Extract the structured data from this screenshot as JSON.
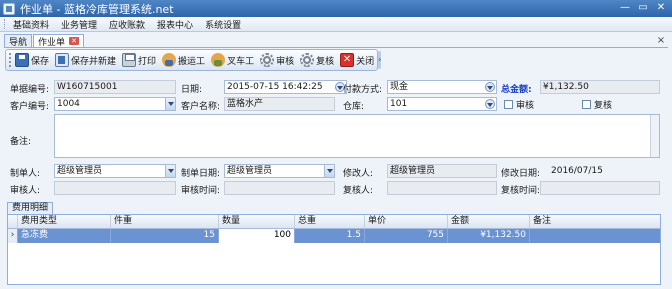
{
  "window": {
    "title": "作业单 - 蓝格冷库管理系统.net",
    "minimize": "—",
    "maximize": "▭",
    "close": "✕"
  },
  "menu": [
    "基础资料",
    "业务管理",
    "应收账款",
    "报表中心",
    "系统设置"
  ],
  "tabs": {
    "nav_label": "导航",
    "active_label": "作业单",
    "tab_close": "✕",
    "strip_close": "×"
  },
  "toolbar": {
    "save": "保存",
    "save_new": "保存并新建",
    "print": "打印",
    "porter": "搬运工",
    "forklift": "叉车工",
    "audit": "审核",
    "review": "复核",
    "close": "关闭",
    "more": "›"
  },
  "form": {
    "order_no_label": "单据编号:",
    "order_no": "W160715001",
    "date_label": "日期:",
    "date": "2015-07-15  16:42:25",
    "pay_label": "付款方式:",
    "pay": "现金",
    "total_label": "总金额:",
    "total": "¥1,132.50",
    "cust_no_label": "客户编号:",
    "cust_no": "1004",
    "cust_name_label": "客户名称:",
    "cust_name": "蓝格水产",
    "warehouse_label": "仓库:",
    "warehouse": "101",
    "audit_check": "审核",
    "review_check": "复核",
    "remarks_label": "备注:",
    "remarks": "",
    "maker_label": "制单人:",
    "maker": "超级管理员",
    "make_date_label": "制单日期:",
    "make_date": "超级管理员",
    "modifier_label": "修改人:",
    "modifier": "超级管理员",
    "mod_date_label": "修改日期:",
    "mod_date": "2016/07/15",
    "auditor_label": "审核人:",
    "auditor": "",
    "audit_time_label": "审核时间:",
    "audit_time": "",
    "reviewer_label": "复核人:",
    "reviewer": "",
    "review_time_label": "复核时间:",
    "review_time": ""
  },
  "detail": {
    "tab_label": "费用明细",
    "columns": [
      "费用类型",
      "件重",
      "数量",
      "总重",
      "单价",
      "金额",
      "备注"
    ],
    "rows": [
      {
        "marker": "›",
        "type": "急冻费",
        "piece_weight": "15",
        "qty": "100",
        "total_weight": "1.5",
        "price": "755",
        "amount": "¥1,132.50",
        "note": ""
      }
    ]
  },
  "colors": {
    "titlebar": "#2e65aa",
    "selected_row": "#6c93d1",
    "total_label": "#1b40c9"
  }
}
